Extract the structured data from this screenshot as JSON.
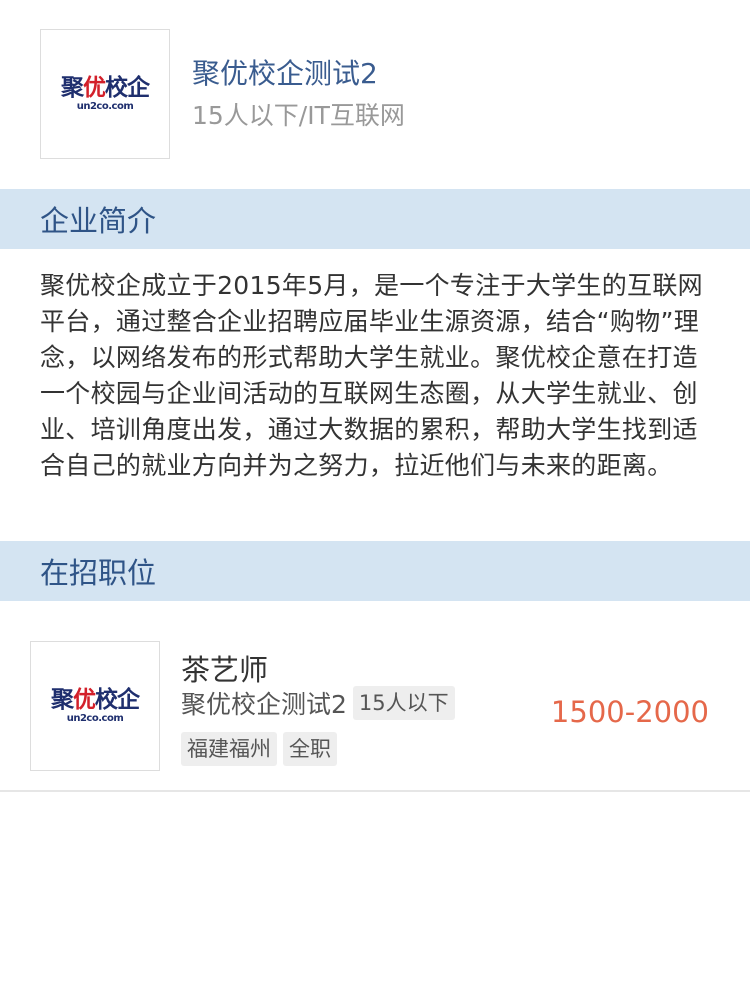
{
  "company": {
    "logo_text_main_1": "聚",
    "logo_text_main_accent": "优",
    "logo_text_main_2": "校企",
    "logo_text_sub": "un2co.com",
    "name": "聚优校企测试2",
    "meta": "15人以下/IT互联网"
  },
  "sections": {
    "intro_title": "企业简介",
    "intro_text": "聚优校企成立于2015年5月，是一个专注于大学生的互联网平台，通过整合企业招聘应届毕业生源资源，结合“购物”理念，以网络发布的形式帮助大学生就业。聚优校企意在打造一个校园与企业间活动的互联网生态圈，从大学生就业、创业、培训角度出发，通过大数据的累积，帮助大学生找到适合自己的就业方向并为之努力，拉近他们与未来的距离。",
    "jobs_title": "在招职位"
  },
  "jobs": [
    {
      "title": "茶艺师",
      "company": "聚优校企测试2",
      "size_tag": "15人以下",
      "location_tag": "福建福州",
      "type_tag": "全职",
      "salary": "1500-2000"
    }
  ],
  "colors": {
    "section_bar_bg": "#d4e4f2",
    "section_title": "#2f5487",
    "company_name": "#3a5c8f",
    "salary": "#e5684a",
    "logo_navy": "#1f2f6e",
    "logo_red": "#d3202a"
  }
}
